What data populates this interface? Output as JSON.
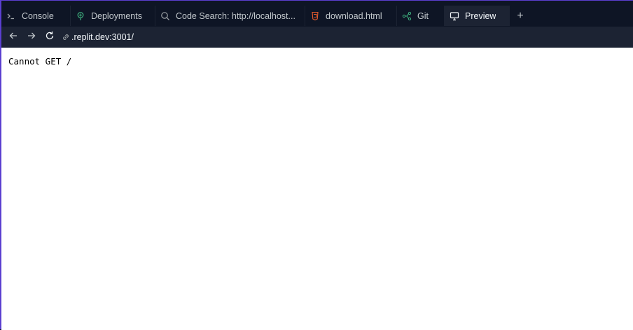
{
  "tabs": [
    {
      "label": "Console",
      "icon": "terminal-icon",
      "active": false
    },
    {
      "label": "Deployments",
      "icon": "deployments-icon",
      "active": false
    },
    {
      "label": "Code Search: http://localhost...",
      "icon": "search-icon",
      "active": false
    },
    {
      "label": "download.html",
      "icon": "html-file-icon",
      "active": false
    },
    {
      "label": "Git",
      "icon": "git-icon",
      "active": false
    },
    {
      "label": "Preview",
      "icon": "monitor-icon",
      "active": true
    }
  ],
  "add_tab_label": "+",
  "toolbar": {
    "url": ".replit.dev:3001/"
  },
  "preview": {
    "body_text": "Cannot GET /"
  },
  "colors": {
    "accent": "#5b3fd0",
    "background": "#0e1525",
    "surface": "#1c2333",
    "deployments_icon": "#3fb27f",
    "html_icon": "#e65c2e",
    "git_icon": "#3fb27f"
  }
}
